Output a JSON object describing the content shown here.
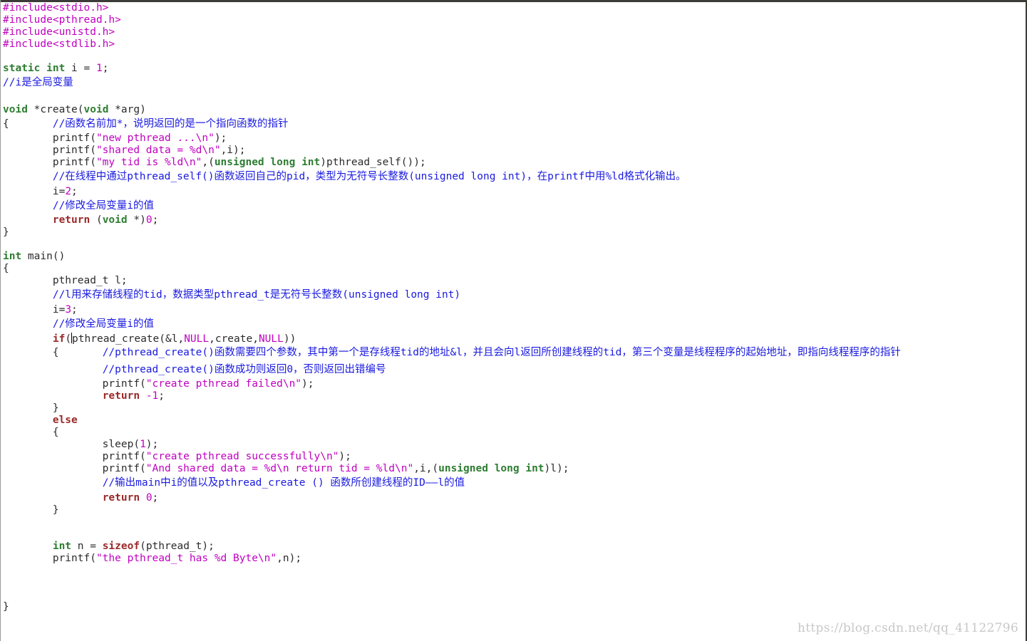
{
  "editor": {
    "lines": [
      {
        "segs": [
          {
            "t": "#include<stdio.h>",
            "c": "pp"
          }
        ]
      },
      {
        "segs": [
          {
            "t": "#include<pthread.h>",
            "c": "pp"
          }
        ]
      },
      {
        "segs": [
          {
            "t": "#include<unistd.h>",
            "c": "pp"
          }
        ]
      },
      {
        "segs": [
          {
            "t": "#include<stdlib.h>",
            "c": "pp"
          }
        ]
      },
      {
        "segs": []
      },
      {
        "segs": [
          {
            "t": "static",
            "c": "kw"
          },
          {
            "t": " ",
            "c": "tx"
          },
          {
            "t": "int",
            "c": "ty"
          },
          {
            "t": " i = ",
            "c": "tx"
          },
          {
            "t": "1",
            "c": "num"
          },
          {
            "t": ";",
            "c": "tx"
          }
        ]
      },
      {
        "cjk": true,
        "segs": [
          {
            "t": "//i是全局变量",
            "c": "cm"
          }
        ]
      },
      {
        "segs": []
      },
      {
        "segs": [
          {
            "t": "void",
            "c": "ty"
          },
          {
            "t": " *create(",
            "c": "tx"
          },
          {
            "t": "void",
            "c": "ty"
          },
          {
            "t": " *arg)",
            "c": "tx"
          }
        ]
      },
      {
        "cjk": true,
        "segs": [
          {
            "t": "{       ",
            "c": "tx"
          },
          {
            "t": "//函数名前加*，说明返回的是一个指向函数的指针",
            "c": "cm"
          }
        ]
      },
      {
        "segs": [
          {
            "t": "        printf(",
            "c": "tx"
          },
          {
            "t": "\"new pthread ...\\n\"",
            "c": "str"
          },
          {
            "t": ");",
            "c": "tx"
          }
        ]
      },
      {
        "segs": [
          {
            "t": "        printf(",
            "c": "tx"
          },
          {
            "t": "\"shared data = %d\\n\"",
            "c": "str"
          },
          {
            "t": ",i);",
            "c": "tx"
          }
        ]
      },
      {
        "segs": [
          {
            "t": "        printf(",
            "c": "tx"
          },
          {
            "t": "\"my tid is %ld\\n\"",
            "c": "str"
          },
          {
            "t": ",(",
            "c": "tx"
          },
          {
            "t": "unsigned",
            "c": "ty"
          },
          {
            "t": " ",
            "c": "tx"
          },
          {
            "t": "long",
            "c": "ty"
          },
          {
            "t": " ",
            "c": "tx"
          },
          {
            "t": "int",
            "c": "ty"
          },
          {
            "t": ")pthread_self());",
            "c": "tx"
          }
        ]
      },
      {
        "cjk": true,
        "segs": [
          {
            "t": "        ",
            "c": "tx"
          },
          {
            "t": "//在线程中通过pthread_self()函数返回自己的pid，类型为无符号长整数(unsigned long int)，在printf中用%ld格式化输出。",
            "c": "cm"
          }
        ]
      },
      {
        "segs": [
          {
            "t": "        i=",
            "c": "tx"
          },
          {
            "t": "2",
            "c": "num"
          },
          {
            "t": ";",
            "c": "tx"
          }
        ]
      },
      {
        "cjk": true,
        "segs": [
          {
            "t": "        ",
            "c": "tx"
          },
          {
            "t": "//修改全局变量i的值",
            "c": "cm"
          }
        ]
      },
      {
        "segs": [
          {
            "t": "        ",
            "c": "tx"
          },
          {
            "t": "return",
            "c": "ctl"
          },
          {
            "t": " (",
            "c": "tx"
          },
          {
            "t": "void",
            "c": "ty"
          },
          {
            "t": " *)",
            "c": "tx"
          },
          {
            "t": "0",
            "c": "num"
          },
          {
            "t": ";",
            "c": "tx"
          }
        ]
      },
      {
        "segs": [
          {
            "t": "}",
            "c": "tx"
          }
        ]
      },
      {
        "segs": []
      },
      {
        "segs": [
          {
            "t": "int",
            "c": "ty"
          },
          {
            "t": " main()",
            "c": "tx"
          }
        ]
      },
      {
        "segs": [
          {
            "t": "{",
            "c": "tx"
          }
        ]
      },
      {
        "segs": [
          {
            "t": "        pthread_t l;",
            "c": "tx"
          }
        ]
      },
      {
        "cjk": true,
        "segs": [
          {
            "t": "        ",
            "c": "tx"
          },
          {
            "t": "//l用来存储线程的tid，数据类型pthread_t是无符号长整数(unsigned long int)",
            "c": "cm"
          }
        ]
      },
      {
        "segs": [
          {
            "t": "        i=",
            "c": "tx"
          },
          {
            "t": "3",
            "c": "num"
          },
          {
            "t": ";",
            "c": "tx"
          }
        ]
      },
      {
        "cjk": true,
        "segs": [
          {
            "t": "        ",
            "c": "tx"
          },
          {
            "t": "//修改全局变量i的值",
            "c": "cm"
          }
        ]
      },
      {
        "cursor": true,
        "segs": [
          {
            "t": "        ",
            "c": "tx"
          },
          {
            "t": "if",
            "c": "ctl"
          },
          {
            "t": "(pthread_create(&l,",
            "c": "tx"
          },
          {
            "t": "NULL",
            "c": "num"
          },
          {
            "t": ",create,",
            "c": "tx"
          },
          {
            "t": "NULL",
            "c": "num"
          },
          {
            "t": "))",
            "c": "tx"
          }
        ]
      },
      {
        "cjk": true,
        "segs": [
          {
            "t": "        {       ",
            "c": "tx"
          },
          {
            "t": "//pthread_create()函数需要四个参数，其中第一个是存线程tid的地址&l，并且会向l返回所创建线程的tid，第三个变量是线程程序的起始地址，即指向线程程序的指针",
            "c": "cm"
          }
        ]
      },
      {
        "cjk": true,
        "segs": [
          {
            "t": "                ",
            "c": "tx"
          },
          {
            "t": "//pthread_create()函数成功则返回0，否则返回出错编号",
            "c": "cm"
          }
        ]
      },
      {
        "segs": [
          {
            "t": "                printf(",
            "c": "tx"
          },
          {
            "t": "\"create pthread failed\\n\"",
            "c": "str"
          },
          {
            "t": ");",
            "c": "tx"
          }
        ]
      },
      {
        "segs": [
          {
            "t": "                ",
            "c": "tx"
          },
          {
            "t": "return",
            "c": "ctl"
          },
          {
            "t": " ",
            "c": "tx"
          },
          {
            "t": "-1",
            "c": "num"
          },
          {
            "t": ";",
            "c": "tx"
          }
        ]
      },
      {
        "segs": [
          {
            "t": "        }",
            "c": "tx"
          }
        ]
      },
      {
        "segs": [
          {
            "t": "        ",
            "c": "tx"
          },
          {
            "t": "else",
            "c": "ctl"
          }
        ]
      },
      {
        "segs": [
          {
            "t": "        {",
            "c": "tx"
          }
        ]
      },
      {
        "segs": [
          {
            "t": "                sleep(",
            "c": "tx"
          },
          {
            "t": "1",
            "c": "num"
          },
          {
            "t": ");",
            "c": "tx"
          }
        ]
      },
      {
        "segs": [
          {
            "t": "                printf(",
            "c": "tx"
          },
          {
            "t": "\"create pthread successfully\\n\"",
            "c": "str"
          },
          {
            "t": ");",
            "c": "tx"
          }
        ]
      },
      {
        "segs": [
          {
            "t": "                printf(",
            "c": "tx"
          },
          {
            "t": "\"And shared data = %d\\n return tid = %ld\\n\"",
            "c": "str"
          },
          {
            "t": ",i,(",
            "c": "tx"
          },
          {
            "t": "unsigned",
            "c": "ty"
          },
          {
            "t": " ",
            "c": "tx"
          },
          {
            "t": "long",
            "c": "ty"
          },
          {
            "t": " ",
            "c": "tx"
          },
          {
            "t": "int",
            "c": "ty"
          },
          {
            "t": ")l);",
            "c": "tx"
          }
        ]
      },
      {
        "cjk": true,
        "segs": [
          {
            "t": "                ",
            "c": "tx"
          },
          {
            "t": "//输出main中i的值以及pthread_create () 函数所创建线程的ID——l的值",
            "c": "cm"
          }
        ]
      },
      {
        "segs": [
          {
            "t": "                ",
            "c": "tx"
          },
          {
            "t": "return",
            "c": "ctl"
          },
          {
            "t": " ",
            "c": "tx"
          },
          {
            "t": "0",
            "c": "num"
          },
          {
            "t": ";",
            "c": "tx"
          }
        ]
      },
      {
        "segs": [
          {
            "t": "        }",
            "c": "tx"
          }
        ]
      },
      {
        "segs": []
      },
      {
        "segs": []
      },
      {
        "segs": [
          {
            "t": "        ",
            "c": "tx"
          },
          {
            "t": "int",
            "c": "ty"
          },
          {
            "t": " n = ",
            "c": "tx"
          },
          {
            "t": "sizeof",
            "c": "ctl"
          },
          {
            "t": "(pthread_t);",
            "c": "tx"
          }
        ]
      },
      {
        "segs": [
          {
            "t": "        printf(",
            "c": "tx"
          },
          {
            "t": "\"the pthread_t has %d Byte\\n\"",
            "c": "str"
          },
          {
            "t": ",n);",
            "c": "tx"
          }
        ]
      },
      {
        "segs": []
      },
      {
        "segs": []
      },
      {
        "segs": []
      },
      {
        "segs": [
          {
            "t": "}",
            "c": "tx"
          }
        ]
      }
    ]
  },
  "watermark": "https://blog.csdn.net/qq_41122796"
}
